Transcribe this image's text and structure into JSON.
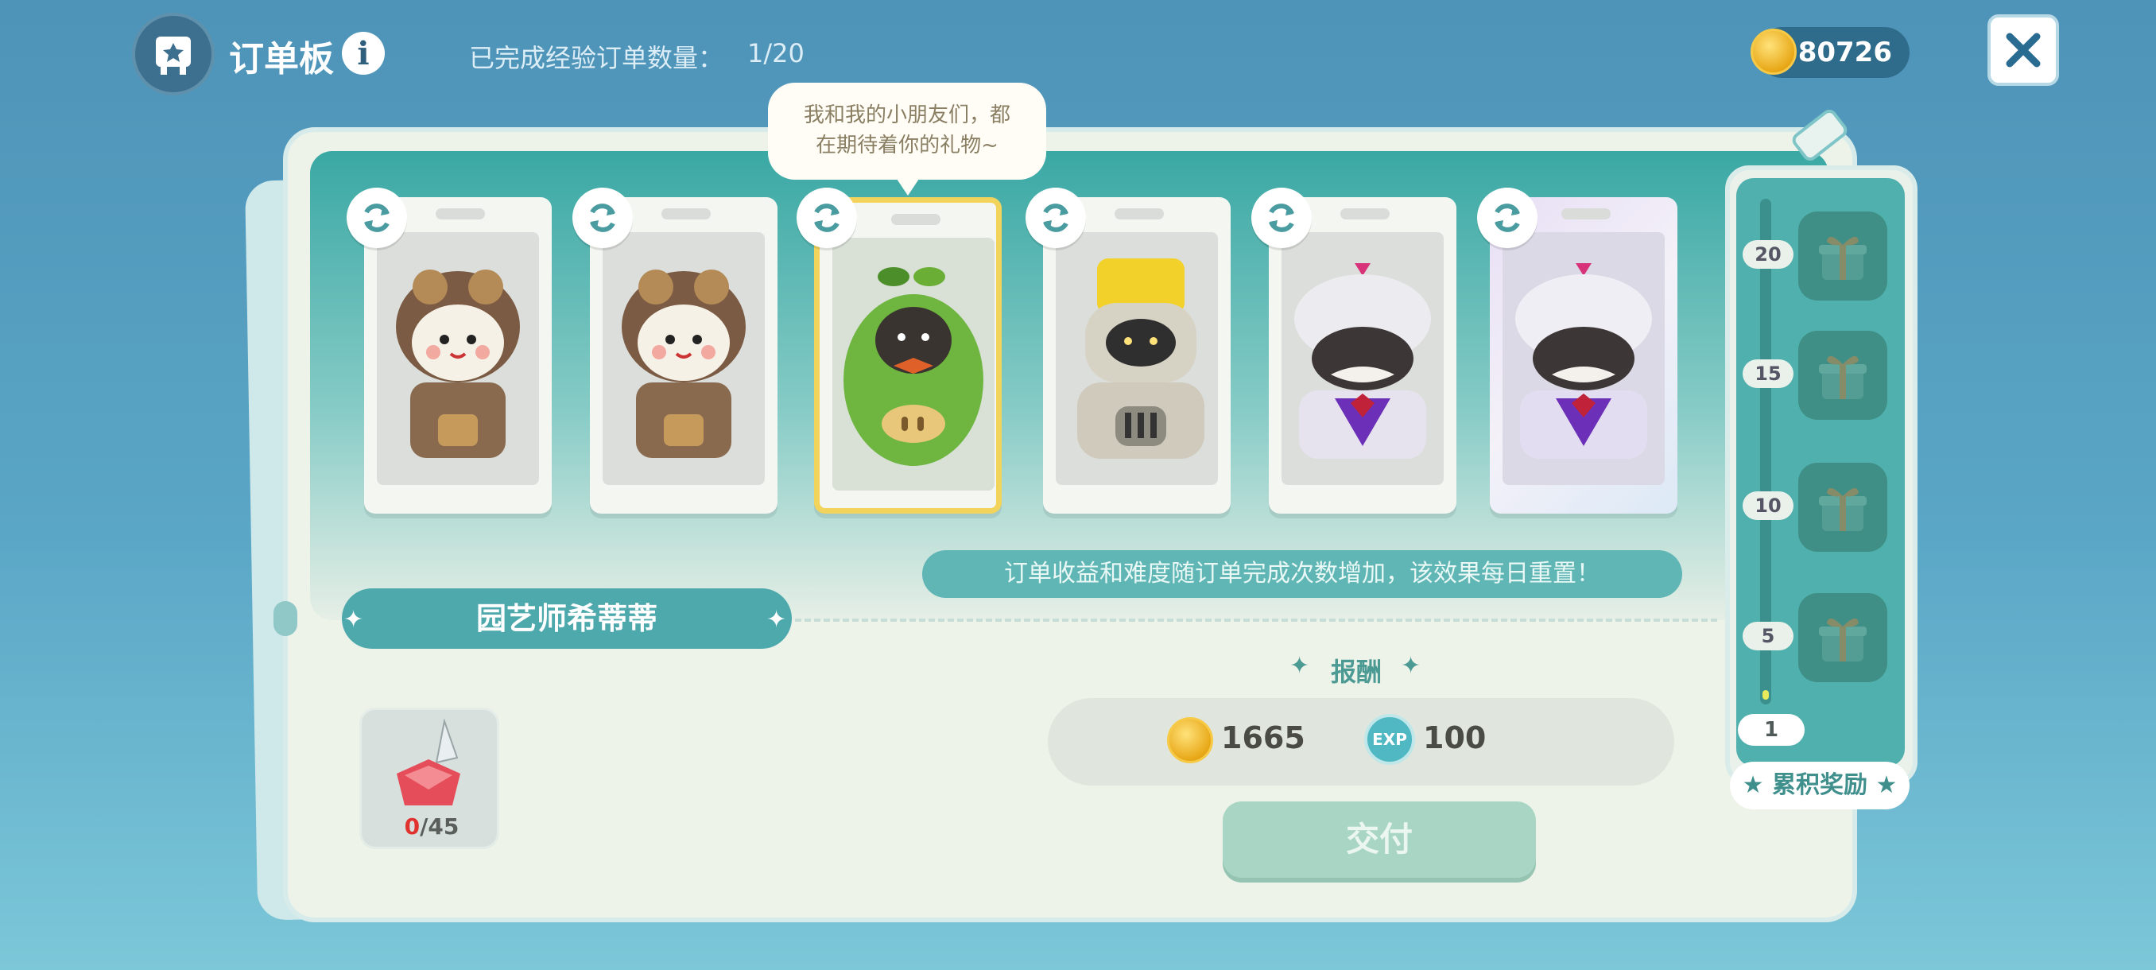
{
  "header": {
    "title": "订单板",
    "info_icon": "i",
    "completed_label": "已完成经验订单数量：",
    "completed_value": "1/20",
    "coins": "80726"
  },
  "bubble": {
    "line1": "我和我的小朋友们，都",
    "line2": "在期待着你的礼物~"
  },
  "cards": [
    {
      "character": "aviator-bunny",
      "selected": false
    },
    {
      "character": "aviator-bunny",
      "selected": false
    },
    {
      "character": "leaf-sprout",
      "selected": true
    },
    {
      "character": "paint-bucket-robot",
      "selected": false
    },
    {
      "character": "royal-mustache",
      "selected": false
    },
    {
      "character": "royal-mustache-shiny",
      "selected": false
    }
  ],
  "order": {
    "npc_name": "园艺师希蒂蒂",
    "hint": "订单收益和难度随订单完成次数增加，该效果每日重置！",
    "required_item": {
      "icon": "red-crystal-icon",
      "have": "0",
      "need": "/45"
    },
    "reward_title": "报酬",
    "reward_coins": "1665",
    "reward_exp_badge": "EXP",
    "reward_exp": "100",
    "deliver_label": "交付"
  },
  "progress": {
    "milestones": [
      "20",
      "15",
      "10",
      "5"
    ],
    "current": "1",
    "level": 0.05,
    "label": "累积奖励"
  },
  "colors": {
    "background": "#4e93b8",
    "accent_teal": "#4ea9ad",
    "selected_border": "#f2d35b",
    "deliver_disabled": "#a9d6c4"
  }
}
